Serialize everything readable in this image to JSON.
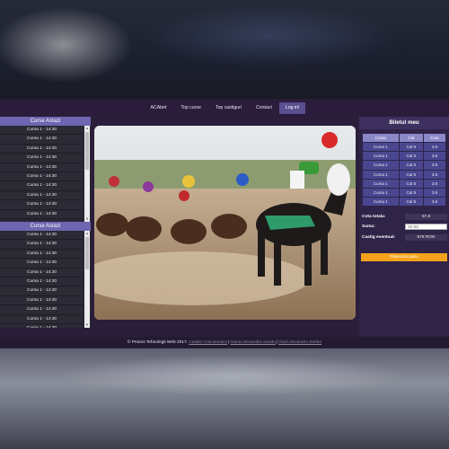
{
  "nav": {
    "items": [
      "ACAbet",
      "Top curse",
      "Top castiguri",
      "Contact"
    ],
    "login": "Log in!"
  },
  "races_today_1": {
    "title": "Curse Astazi",
    "rows": [
      "Cursa 1 - 14:30",
      "Cursa 1 - 14:30",
      "Cursa 1 - 14:30",
      "Cursa 1 - 14:30",
      "Cursa 1 - 14:30",
      "Cursa 1 - 14:30",
      "Cursa 1 - 14:30",
      "Cursa 1 - 14:30",
      "Cursa 1 - 14:30",
      "Cursa 1 - 14:30"
    ]
  },
  "races_today_2": {
    "title": "Curse Astazi",
    "rows": [
      "Cursa 1 - 14:30",
      "Cursa 1 - 14:30",
      "Cursa 1 - 14:30",
      "Cursa 1 - 14:30",
      "Cursa 1 - 14:30",
      "Cursa 1 - 14:30",
      "Cursa 1 - 14:30",
      "Cursa 1 - 14:30",
      "Cursa 1 - 14:30",
      "Cursa 1 - 14:30",
      "Cursa 1 - 14:30"
    ]
  },
  "ticket": {
    "title": "Biletul meu",
    "headers": [
      "Cursa",
      "Cal",
      "Cota"
    ],
    "rows": [
      [
        "Cursa 1",
        "Cal 5",
        "3.6"
      ],
      [
        "Cursa 1",
        "Cal 5",
        "3.6"
      ],
      [
        "Cursa 1",
        "Cal 5",
        "3.6"
      ],
      [
        "Cursa 1",
        "Cal 5",
        "3.6"
      ],
      [
        "Cursa 1",
        "Cal 5",
        "3.6"
      ],
      [
        "Cursa 1",
        "Cal 5",
        "3.6"
      ],
      [
        "Cursa 1",
        "Cal 5",
        "3.6"
      ]
    ],
    "total_odds_label": "Cota totala:",
    "total_odds_value": "57.8",
    "amount_label": "Suma:",
    "amount_value": "10.00",
    "potential_label": "Castig eventual:",
    "potential_value": "578 RON",
    "place_bet": "Plaseaza pariu"
  },
  "footer": {
    "copyright": "© Proiect Tehnologii Web 2017.",
    "authors": [
      "Catalin Craciunescu",
      "Ioana-Alexandra Sandu",
      "Vlad-Alexandru Stefan"
    ]
  },
  "colors": {
    "accent": "#6e66b0",
    "button": "#f5a21b",
    "table_cell": "#4a4790"
  }
}
